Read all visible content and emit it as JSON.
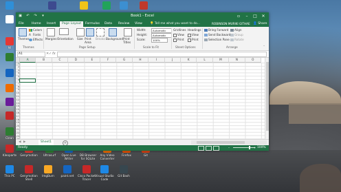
{
  "desktop": {
    "icons_top": [
      {
        "label": "",
        "color": "#2f8fd8"
      },
      {
        "label": "",
        "color": "#3d4a8f"
      },
      {
        "label": "",
        "color": "#f0c419"
      },
      {
        "label": "",
        "color": "#22a35a"
      },
      {
        "label": "",
        "color": "#3c8fd1"
      },
      {
        "label": "",
        "color": "#c0392b"
      }
    ],
    "icons_left": [
      {
        "label": "",
        "color": "#ffffff"
      },
      {
        "label": "MI",
        "color": "#e53935"
      },
      {
        "label": "",
        "color": "#2e7d32"
      },
      {
        "label": "",
        "color": "#1565c0"
      },
      {
        "label": "",
        "color": "#ef6c00"
      },
      {
        "label": "",
        "color": "#6a1b9a"
      },
      {
        "label": "",
        "color": "#c62828"
      },
      {
        "label": "Clean",
        "color": "#2e7d32"
      }
    ],
    "icons_row2": [
      {
        "label": "Kleoparte",
        "color": "#c62828"
      },
      {
        "label": "Genymotion",
        "color": "#e53935"
      },
      {
        "label": "Ultrasurf",
        "color": "#2e7d32"
      },
      {
        "label": "Open Live Writer",
        "color": "#1565c0"
      },
      {
        "label": "DB Browser for SQLite",
        "color": "#37474f"
      },
      {
        "label": "Any Video Converter",
        "color": "#ef6c00"
      },
      {
        "label": "Firefox",
        "color": "#e65100"
      },
      {
        "label": "Git",
        "color": "#d84315"
      }
    ],
    "icons_bottom": [
      {
        "label": "This PC",
        "color": "#1e88e5"
      },
      {
        "label": "Genymotion Shell",
        "color": "#c62828"
      },
      {
        "label": "ImgBurn",
        "color": "#f9a825"
      },
      {
        "label": "paint.net",
        "color": "#1565c0"
      },
      {
        "label": "Cisco Packet Tracer",
        "color": "#c62828"
      },
      {
        "label": "Visual Studio Code",
        "color": "#1e88e5"
      },
      {
        "label": "Git Bash",
        "color": "#37474f"
      }
    ]
  },
  "excel": {
    "title": "Book1 - Excel",
    "tabs": [
      "File",
      "Home",
      "Insert",
      "Page Layout",
      "Formulas",
      "Data",
      "Review",
      "View"
    ],
    "active_tab": "Page Layout",
    "tell_me": "Tell me what you want to do...",
    "user": "ROBINSON MURIKI GITHAE",
    "share": "Share",
    "ribbon": {
      "themes": {
        "themes": "Themes",
        "colors": "Colors",
        "fonts": "Fonts",
        "effects": "Effects",
        "group": "Themes"
      },
      "page_setup": {
        "margins": "Margins",
        "orientation": "Orientation",
        "size": "Size",
        "print_area": "Print Area",
        "breaks": "Breaks",
        "background": "Background",
        "print_titles": "Print Titles",
        "group": "Page Setup"
      },
      "scale": {
        "width": "Width:",
        "height": "Height:",
        "scale": "Scale:",
        "width_val": "Automatic",
        "height_val": "Automatic",
        "scale_val": "100%",
        "group": "Scale to Fit"
      },
      "sheet_options": {
        "gridlines": "Gridlines",
        "headings": "Headings",
        "view": "View",
        "print": "Print",
        "group": "Sheet Options"
      },
      "arrange": {
        "bring_forward": "Bring Forward",
        "send_backward": "Send Backward",
        "selection_pane": "Selection Pane",
        "align": "Align",
        "group_btn": "Group",
        "rotate": "Rotate",
        "group": "Arrange"
      }
    },
    "name_box": "A1",
    "fx": "fx",
    "columns": [
      "A",
      "B",
      "C",
      "D",
      "E",
      "F",
      "G",
      "H",
      "I",
      "J",
      "K",
      "L",
      "M",
      "N",
      "O"
    ],
    "rows": [
      "1",
      "2",
      "3",
      "4",
      "5",
      "6",
      "7",
      "8",
      "9",
      "10",
      "11",
      "12",
      "13",
      "14",
      "15",
      "16",
      "17",
      "18",
      "19",
      "20",
      "21",
      "22",
      "23",
      "24",
      "25"
    ],
    "sheet_tab": "Sheet1",
    "status": "Ready",
    "zoom": "100%"
  }
}
